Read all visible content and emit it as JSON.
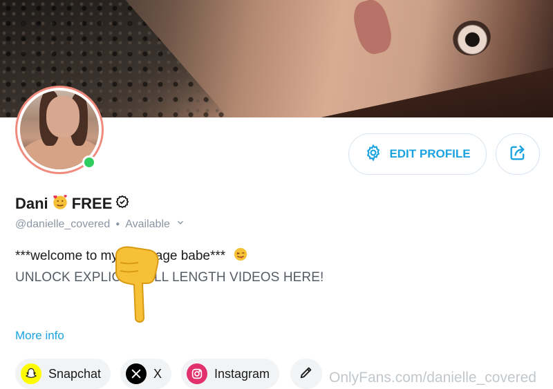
{
  "profile": {
    "display_name": "Dani",
    "name_suffix": "FREE",
    "handle": "@danielle_covered",
    "status": "Available",
    "online": true
  },
  "bio": {
    "line1": "***welcome to my free page babe***",
    "line2": "UNLOCK EXPLICIT FULL LENGTH VIDEOS HERE!",
    "more_info": "More info"
  },
  "actions": {
    "edit_profile": "EDIT PROFILE"
  },
  "social_links": [
    {
      "label": "Snapchat",
      "icon": "snapchat-icon",
      "color": "#FFFC00"
    },
    {
      "label": "X",
      "icon": "x-icon",
      "color": "#000000"
    },
    {
      "label": "Instagram",
      "icon": "instagram-icon",
      "color": "#E1306C"
    }
  ],
  "watermark": "OnlyFans.com/danielle_covered",
  "colors": {
    "accent": "#1aa3e0",
    "online": "#2fcc5f",
    "avatar_ring": "#f08a7c"
  }
}
